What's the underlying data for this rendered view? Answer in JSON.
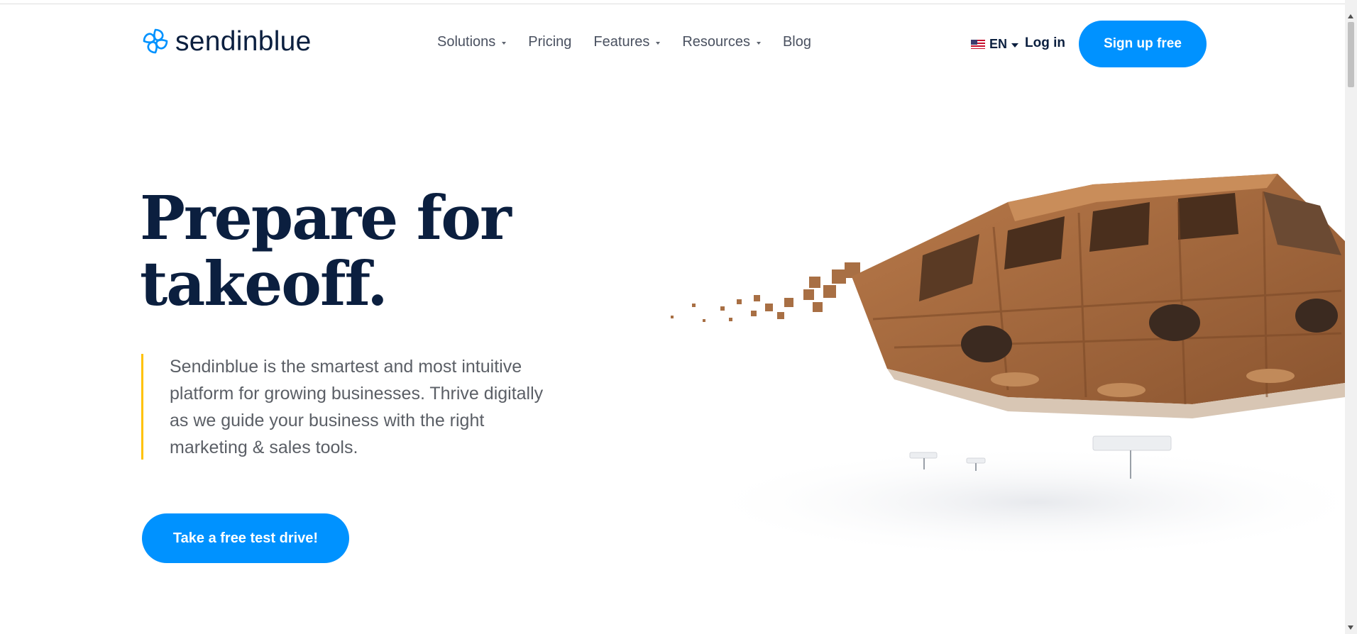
{
  "header": {
    "brand": "sendinblue",
    "logo_icon": "spiral-logo-icon",
    "nav": [
      {
        "label": "Solutions",
        "dropdown": true
      },
      {
        "label": "Pricing",
        "dropdown": false
      },
      {
        "label": "Features",
        "dropdown": true
      },
      {
        "label": "Resources",
        "dropdown": true
      },
      {
        "label": "Blog",
        "dropdown": false
      }
    ],
    "language": {
      "label": "EN",
      "flag_icon": "us-flag-icon"
    },
    "login_label": "Log in",
    "signup_label": "Sign up free"
  },
  "hero": {
    "title_line1": "Prepare for",
    "title_line2": "takeoff.",
    "description": "Sendinblue is the smartest and most intuitive platform for growing businesses. Thrive digitally as we guide your business with the right marketing & sales tools.",
    "cta_label": "Take a free test drive!",
    "illustration": "wooden-toy-van-illustration"
  },
  "colors": {
    "brand_blue": "#0092ff",
    "navy": "#0b1f3f",
    "accent_yellow": "#ffc200",
    "body_text": "#5b5f66"
  }
}
